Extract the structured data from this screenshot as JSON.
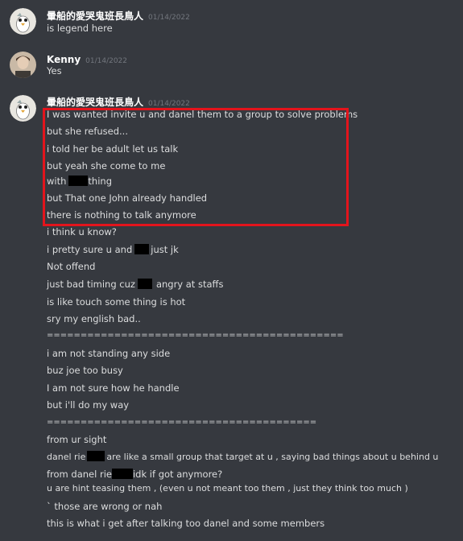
{
  "messages": [
    {
      "author": "暈船的愛哭鬼班長鳥人",
      "timestamp": "01/14/2022",
      "lines": [
        "is legend here"
      ]
    },
    {
      "author": "Kenny",
      "timestamp": "01/14/2022",
      "lines": [
        "Yes"
      ]
    },
    {
      "author": "暈船的愛哭鬼班長鳥人",
      "timestamp": "01/14/2022",
      "lines": [
        "I was wanted invite u and danel them to a group to solve problems",
        "but she refused...",
        "i told her be adult let us talk",
        "but yeah she come to me",
        "with",
        "thing",
        "but That one John already handled",
        "there is nothing to talk anymore",
        "i think u know?",
        "i pretty sure u and",
        "just jk",
        "Not offend",
        "just bad timing  cuz",
        "angry at staffs",
        "is like touch some thing is hot",
        "sry my english bad..",
        "============================================",
        "i am not standing any side",
        "buz joe too busy",
        "I am not sure how he handle",
        "but i'll do my way",
        "========================================",
        "from ur sight",
        "danel rie",
        "are like a small group that target at u , saying bad things about u behind u",
        "from danel rie",
        "idk if got anymore?",
        "u are hint teasing them   , (even u not meant too them , just they think too much )",
        "` those are wrong or nah",
        "this is what i get after talking too danel and some members"
      ]
    }
  ],
  "colors": {
    "background": "#36393f",
    "text": "#dcddde",
    "username": "#ffffff",
    "timestamp": "#72767d",
    "highlight": "#e3141c",
    "redaction": "#000000"
  },
  "icons": [
    "cartoon-bird-avatar",
    "kenny-photo-avatar"
  ]
}
